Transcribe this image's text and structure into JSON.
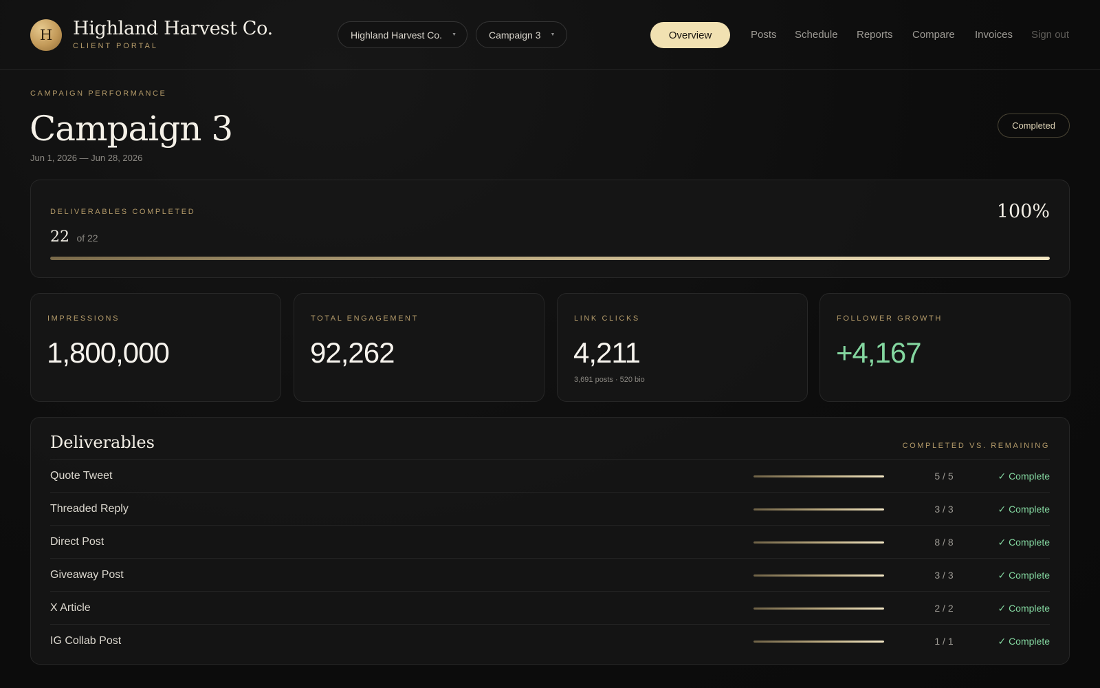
{
  "brand": {
    "logo_letter": "H",
    "title": "Highland Harvest Co.",
    "subtitle": "CLIENT PORTAL"
  },
  "selectors": {
    "client": "Highland Harvest Co.",
    "campaign": "Campaign 3"
  },
  "nav": {
    "overview": "Overview",
    "posts": "Posts",
    "schedule": "Schedule",
    "reports": "Reports",
    "compare": "Compare",
    "invoices": "Invoices",
    "sign_out": "Sign out"
  },
  "page": {
    "eyebrow": "CAMPAIGN PERFORMANCE",
    "title": "Campaign 3",
    "dates": "Jun 1, 2026 — Jun 28, 2026",
    "status": "Completed"
  },
  "progress": {
    "label": "DELIVERABLES COMPLETED",
    "completed": "22",
    "total_text": "of 22",
    "percent_text": "100%",
    "fraction": 1.0
  },
  "stats": {
    "impressions": {
      "label": "IMPRESSIONS",
      "value": "1,800,000"
    },
    "engagement": {
      "label": "TOTAL ENGAGEMENT",
      "value": "92,262"
    },
    "clicks": {
      "label": "LINK CLICKS",
      "value": "4,211",
      "sub": "3,691 posts · 520 bio"
    },
    "followers": {
      "label": "FOLLOWER GROWTH",
      "value": "+4,167"
    }
  },
  "deliverables": {
    "title": "Deliverables",
    "legend": "COMPLETED VS. REMAINING",
    "rows": [
      {
        "name": "Quote Tweet",
        "count": "5 / 5",
        "fraction": 1.0,
        "status": "✓ Complete"
      },
      {
        "name": "Threaded Reply",
        "count": "3 / 3",
        "fraction": 1.0,
        "status": "✓ Complete"
      },
      {
        "name": "Direct Post",
        "count": "8 / 8",
        "fraction": 1.0,
        "status": "✓ Complete"
      },
      {
        "name": "Giveaway Post",
        "count": "3 / 3",
        "fraction": 1.0,
        "status": "✓ Complete"
      },
      {
        "name": "X Article",
        "count": "2 / 2",
        "fraction": 1.0,
        "status": "✓ Complete"
      },
      {
        "name": "IG Collab Post",
        "count": "1 / 1",
        "fraction": 1.0,
        "status": "✓ Complete"
      }
    ]
  },
  "colors": {
    "accent_gold": "#f1e1b2",
    "success_green": "#84d7a0",
    "background": "#0c0c0c"
  },
  "icons": {
    "caret": "chevron-down-icon",
    "check": "check-icon"
  }
}
